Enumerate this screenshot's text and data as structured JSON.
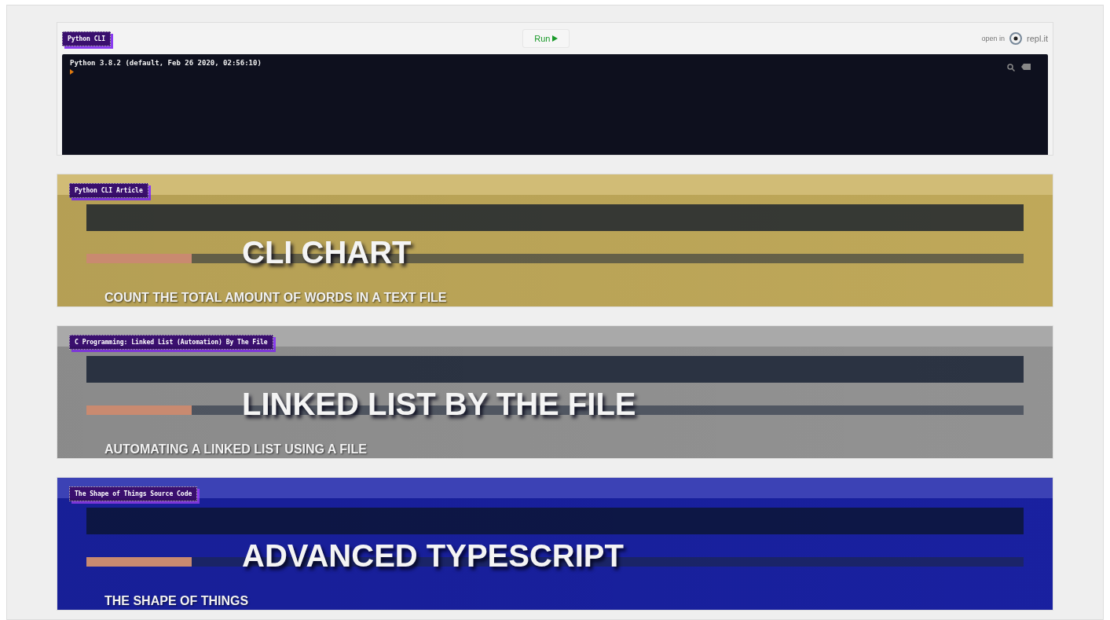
{
  "repl": {
    "tag": "Python CLI",
    "run_button": "Run",
    "open_in": "open in",
    "brand": "repl.it",
    "console": [
      "Python 3.8.2 (default, Feb 26 2020, 02:56:10)"
    ]
  },
  "banners": [
    {
      "tag": "Python CLI Article",
      "title": "CLI CHART",
      "subtitle": "COUNT THE TOTAL AMOUNT OF WORDS IN A TEXT FILE",
      "color": "#c9b15e"
    },
    {
      "tag": "C Programming: Linked List (Automation) By The File",
      "title": "LINKED LIST BY THE FILE",
      "subtitle": "AUTOMATING A LINKED LIST USING A FILE",
      "color": "#9a9a9a"
    },
    {
      "tag": "The Shape of Things Source Code",
      "title": "ADVANCED TYPESCRIPT",
      "subtitle": "THE SHAPE OF THINGS",
      "color": "#1a22a8"
    }
  ]
}
